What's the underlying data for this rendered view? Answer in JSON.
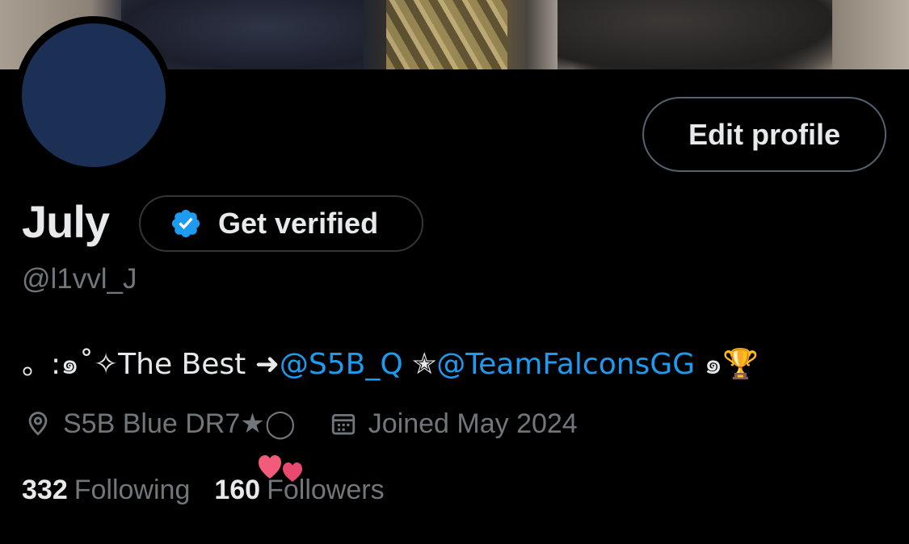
{
  "profile": {
    "name": "July",
    "handle": "@l1vvl_J",
    "edit_label": "Edit profile",
    "verify_label": "Get verified",
    "bio": {
      "prefix": "。:๑˚✧The Best ➜",
      "mention1": "@S5B_Q",
      "middle": " ✭",
      "mention2": "@TeamFalconsGG",
      "suffix": " ๑",
      "trophy": "🏆"
    },
    "location": "S5B Blue DR7★◯",
    "joined": "Joined May 2024",
    "following_count": "332",
    "following_label": "Following",
    "followers_count": "160",
    "followers_label": "Followers"
  },
  "icons": {
    "location": "location-pin-icon",
    "calendar": "calendar-icon",
    "verified": "verified-badge-icon",
    "hearts": "hearts-icon"
  },
  "colors": {
    "background": "#000000",
    "text": "#e7e9ea",
    "muted": "#71767b",
    "accent": "#1d9bf0",
    "avatar": "#1c2f54"
  }
}
